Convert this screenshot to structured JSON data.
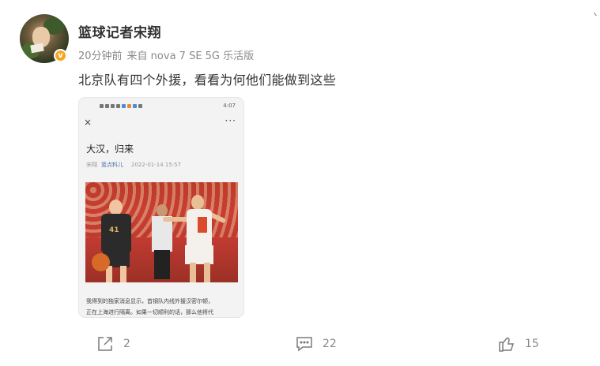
{
  "post": {
    "username": "篮球记者宋翔",
    "time": "20分钟前",
    "source": "来自 nova 7 SE 5G 乐活版",
    "text": "北京队有四个外援，看看为何他们能做到这些",
    "verified_color": "#f5a623"
  },
  "screenshot": {
    "status_time": "4:07",
    "article_title": "大汉，归来",
    "author": "宋翔",
    "channel": "篮点料儿",
    "date": "2022-01-14 15:57",
    "body_line1": "我得到的独家消息显示，首钢队内线外援汉密尔顿，",
    "body_line2": "正在上海进行隔离。如果一切顺利的话，那么他将代",
    "close_icon": "×",
    "more_icon": "···"
  },
  "actions": {
    "share_count": "2",
    "comment_count": "22",
    "like_count": "15"
  }
}
